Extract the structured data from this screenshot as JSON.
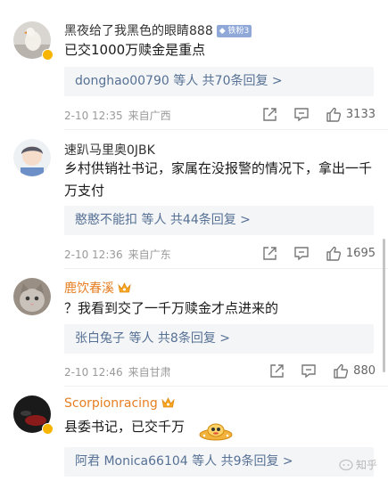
{
  "comments": [
    {
      "user": "黑夜给了我黑色的眼睛888",
      "fan_badge": "铁粉3",
      "text": "已交1000万赎金是重点",
      "replies_users": "donghao00790",
      "replies_suffix": " 等人 ",
      "replies_count": "共70条回复 >",
      "date": "2-10 12:35",
      "location": "来自广西",
      "likes": "3133"
    },
    {
      "user": "速趴马里奥0JBK",
      "text": "乡村供销社书记，家属在没报警的情况下，拿出一千万支付",
      "replies_users": "憨憨不能扣",
      "replies_suffix": " 等人 ",
      "replies_count": "共44条回复 >",
      "date": "2-10 12:36",
      "location": "来自广东",
      "likes": "1695"
    },
    {
      "user": "鹿饮春溪",
      "text": "？我看到交了一千万赎金才点进来的",
      "replies_users": "张白兔子",
      "replies_suffix": " 等人 ",
      "replies_count": "共8条回复 >",
      "date": "2-10 12:46",
      "location": "来自甘肃",
      "likes": "880"
    },
    {
      "user": "Scorpionracing",
      "text": "县委书记，已交千万",
      "replies_users": "阿君 Monica66104",
      "replies_suffix": " 等人 ",
      "replies_count": "共9条回复 >"
    }
  ],
  "watermark": "知乎",
  "icons": [
    "share-icon",
    "comment-icon",
    "like-icon",
    "vip-badge-icon",
    "crown-icon",
    "ufo-emoji-icon"
  ],
  "colors": {
    "link": "#567195",
    "gold_name": "#e67e22",
    "meta": "#9a9a9a",
    "reply_bg": "#f4f5f7"
  }
}
